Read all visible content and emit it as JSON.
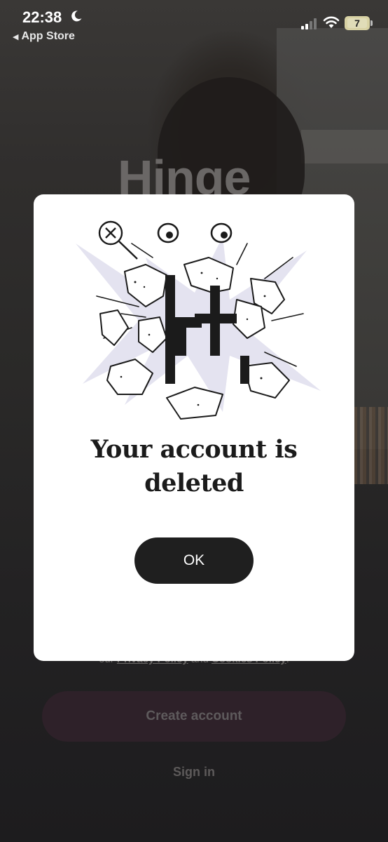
{
  "status_bar": {
    "time": "22:38",
    "back_label": "App Store",
    "battery": "7"
  },
  "background": {
    "logo_text": "Hinge",
    "legal_prefix": "our",
    "privacy_link": "Privacy Policy",
    "legal_and": "and",
    "cookies_link": "Cookies Policy",
    "legal_suffix": ".",
    "create_account_label": "Create account",
    "sign_in_label": "Sign in"
  },
  "modal": {
    "title": "Your account is deleted",
    "ok_label": "OK"
  },
  "colors": {
    "modal_bg": "#ffffff",
    "button_dark": "#1f1f1f",
    "create_btn_dim": "#2e2129",
    "backdrop": "#1c1b1d"
  }
}
